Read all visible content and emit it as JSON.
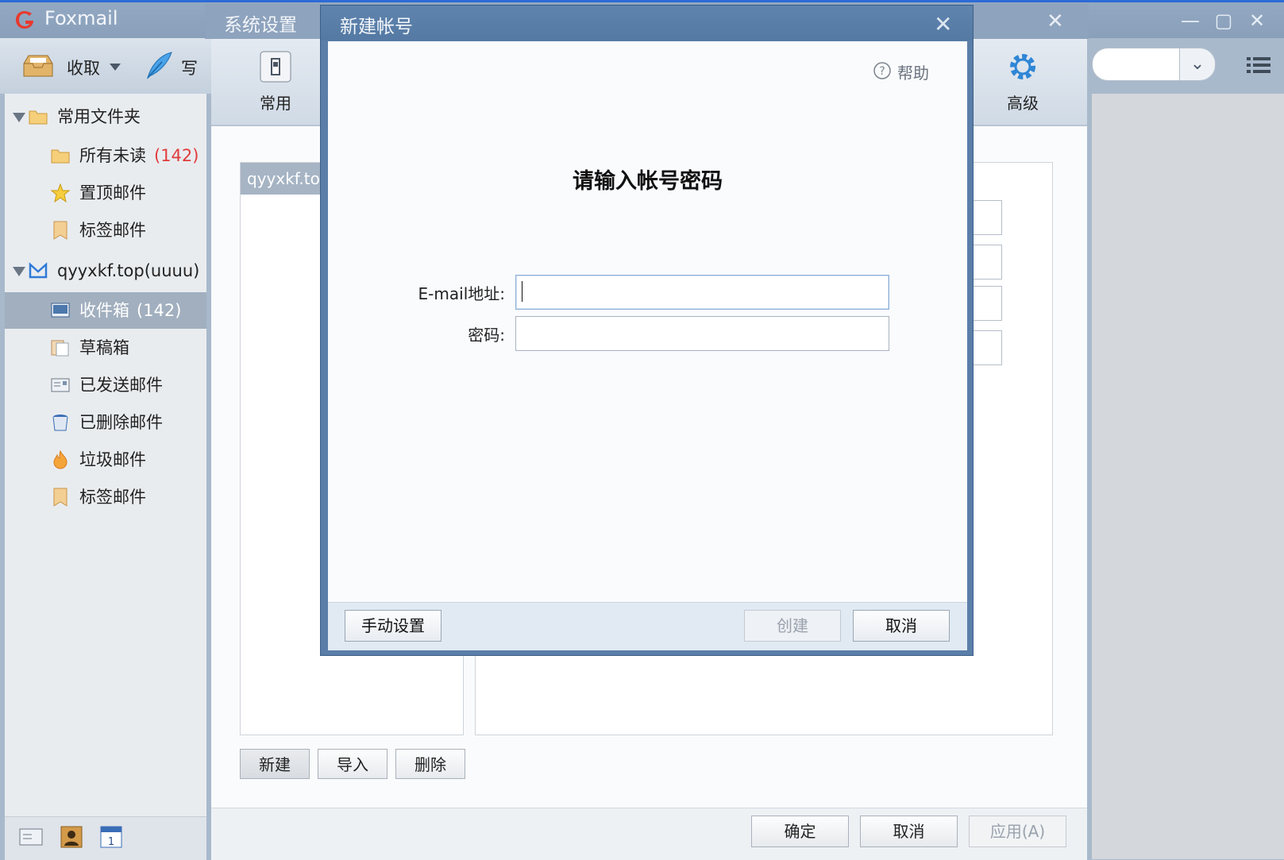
{
  "app": {
    "title": "Foxmail"
  },
  "main_toolbar": {
    "receive_label": "收取",
    "compose_label": "写"
  },
  "sidebar": {
    "groups": [
      {
        "label": "常用文件夹"
      },
      {
        "label": "qyyxkf.top(uuuu)"
      }
    ],
    "favorites": [
      {
        "label": "所有未读",
        "count": "(142)"
      },
      {
        "label": "置顶邮件"
      },
      {
        "label": "标签邮件"
      }
    ],
    "account_folders": [
      {
        "label": "收件箱",
        "count": "(142)"
      },
      {
        "label": "草稿箱"
      },
      {
        "label": "已发送邮件"
      },
      {
        "label": "已删除邮件"
      },
      {
        "label": "垃圾邮件"
      },
      {
        "label": "标签邮件"
      }
    ]
  },
  "settings": {
    "title": "系统设置",
    "tabs": {
      "general": "常用",
      "advanced": "高级"
    },
    "account_selected": "qyyxkf.to",
    "buttons": {
      "new": "新建",
      "import": "导入",
      "delete": "删除"
    },
    "footer": {
      "ok": "确定",
      "cancel": "取消",
      "apply": "应用(A)"
    }
  },
  "dialog": {
    "title": "新建帐号",
    "help": "帮助",
    "heading": "请输入帐号密码",
    "email_label": "E-mail地址:",
    "email_value": "",
    "password_label": "密码:",
    "password_value": "",
    "buttons": {
      "manual": "手动设置",
      "create": "创建",
      "cancel": "取消"
    }
  },
  "colors": {
    "dialog_frame": "#5a7ea8",
    "selected_row": "#a1afbf",
    "unread_count": "#e03c3c",
    "accent_line": "#2d6ad6"
  }
}
